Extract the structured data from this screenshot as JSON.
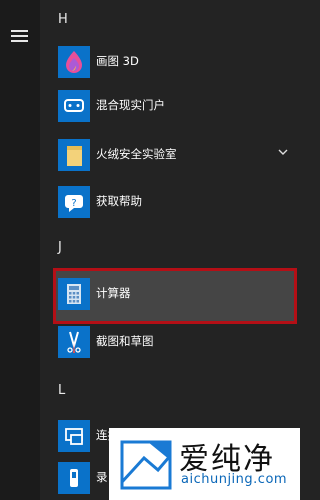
{
  "sidebar": {
    "menu_icon": "hamburger-icon"
  },
  "sections": [
    {
      "letter": "H"
    },
    {
      "letter": "J"
    },
    {
      "letter": "L"
    }
  ],
  "apps": [
    {
      "label": "画图 3D",
      "icon": "paint3d-icon",
      "tile_color": "#0a72c9"
    },
    {
      "label": "混合现实门户",
      "icon": "mixed-reality-icon",
      "tile_color": "#0a72c9"
    },
    {
      "label": "火绒安全实验室",
      "icon": "folder-icon",
      "tile_color": "#0a72c9",
      "expandable": true
    },
    {
      "label": "获取帮助",
      "icon": "help-icon",
      "tile_color": "#0a72c9"
    },
    {
      "label": "计算器",
      "icon": "calculator-icon",
      "tile_color": "#0a72c9",
      "highlighted": true
    },
    {
      "label": "截图和草图",
      "icon": "snip-sketch-icon",
      "tile_color": "#0a72c9"
    },
    {
      "label": "连接",
      "icon": "connect-icon",
      "tile_color": "#0a72c9"
    },
    {
      "label": "录",
      "icon": "voice-recorder-icon",
      "tile_color": "#0a72c9"
    }
  ],
  "watermark": {
    "name": "爱纯净",
    "url": "aichunjing.com"
  },
  "colors": {
    "highlight_border": "#b40f16",
    "tile": "#0a72c9",
    "background": "#232323"
  }
}
